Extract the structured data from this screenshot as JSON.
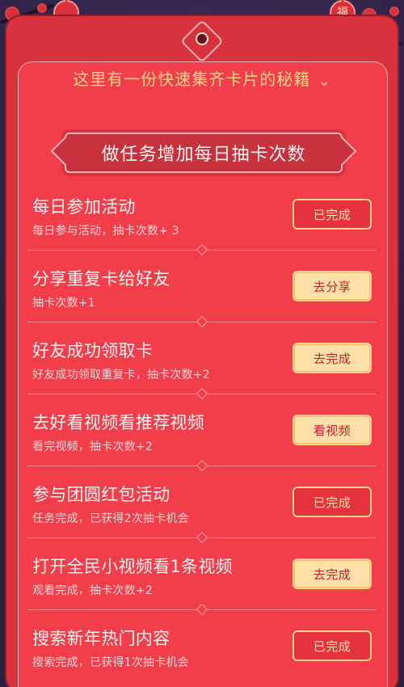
{
  "header": {
    "secret_line": "这里有一份快速集齐卡片的秘籍",
    "chevron_glyph": "⌄"
  },
  "ribbon": {
    "title": "做任务增加每日抽卡次数"
  },
  "decor": {
    "lantern_left_glyph": "",
    "lantern_right_glyph": "福"
  },
  "tasks": [
    {
      "title": "每日参加活动",
      "subtitle": "每日参与活动，抽卡次数+ 3",
      "button_label": "已完成",
      "state": "done"
    },
    {
      "title": "分享重复卡给好友",
      "subtitle": "抽卡次数+1",
      "button_label": "去分享",
      "state": "action"
    },
    {
      "title": "好友成功领取卡",
      "subtitle": "好友成功领取重复卡，抽卡次数+2",
      "button_label": "去完成",
      "state": "action"
    },
    {
      "title": "去好看视频看推荐视频",
      "subtitle": "看完视频，抽卡次数+2",
      "button_label": "看视频",
      "state": "action"
    },
    {
      "title": "参与团圆红包活动",
      "subtitle": "任务完成，已获得2次抽卡机会",
      "button_label": "已完成",
      "state": "done"
    },
    {
      "title": "打开全民小视频看1条视频",
      "subtitle": "观看完成，抽卡次数+2",
      "button_label": "去完成",
      "state": "action"
    },
    {
      "title": "搜索新年热门内容",
      "subtitle": "搜索完成，已获得1次抽卡机会",
      "button_label": "已完成",
      "state": "done"
    }
  ],
  "colors": {
    "background": "#2a1f3d",
    "card": "#d9323f",
    "card_inner": "#f23d4b",
    "gold": "#ffd48a",
    "action_button": "#ffe0a9"
  }
}
